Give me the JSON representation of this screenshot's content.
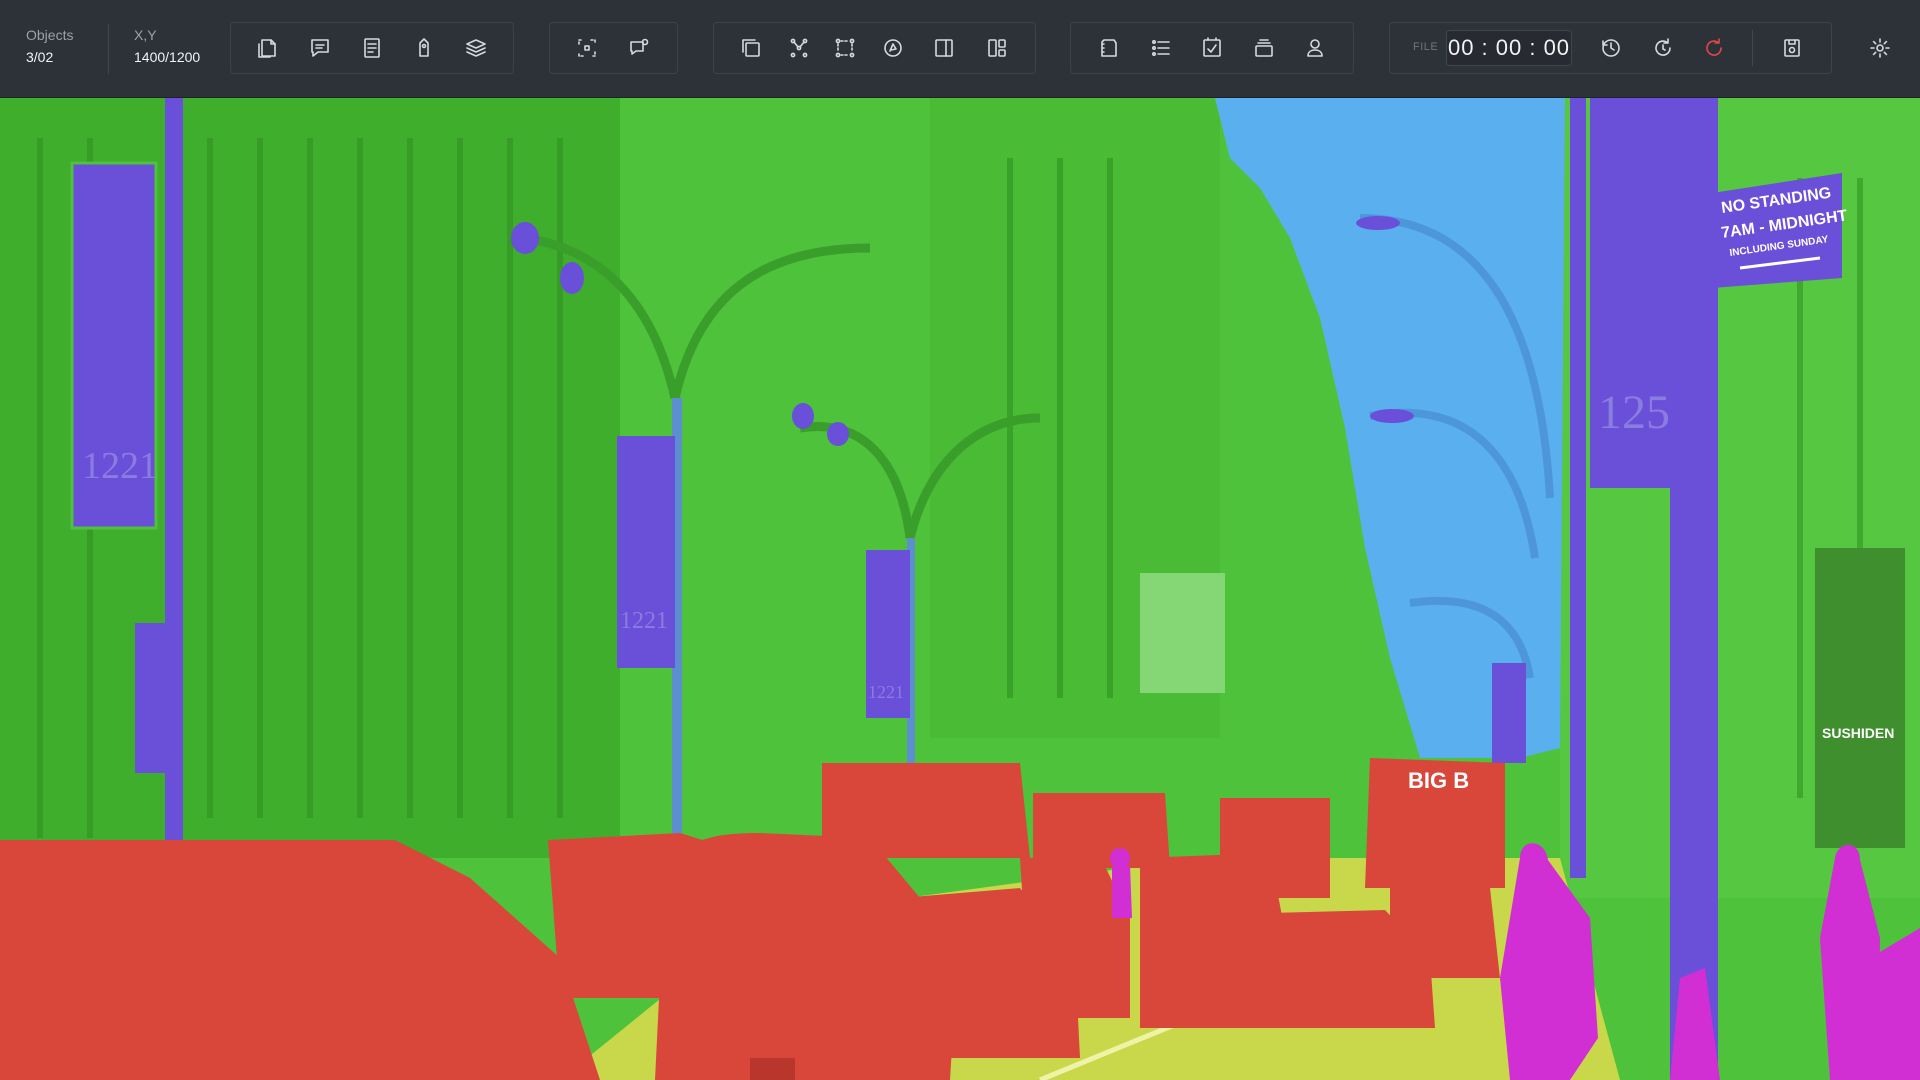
{
  "app": {
    "accent": "#e04848"
  },
  "stats": {
    "objects_label": "Objects",
    "objects_value": "3/02",
    "xy_label": "X,Y",
    "xy_value": "1400/1200"
  },
  "toolbar": {
    "group1": [
      "new-document-icon",
      "comment-icon",
      "list-document-icon",
      "tag-icon",
      "layers-icon"
    ],
    "group2": [
      "select-region-icon",
      "add-comment-icon"
    ],
    "group3": [
      "copy-icon",
      "keypoints-icon",
      "bounding-points-icon",
      "polygon-icon",
      "split-icon",
      "layout-icon"
    ],
    "group4": [
      "clipboard-icon",
      "checklist-icon",
      "checked-document-icon",
      "stack-icon",
      "user-icon"
    ],
    "file_label": "FILE",
    "timer": "00 : 00 : 00",
    "timer_buttons": [
      "history-icon",
      "redo-icon",
      "reset-icon"
    ],
    "save_icon": "save-icon",
    "settings_icon": "gear-icon"
  },
  "scene": {
    "sign_lines": [
      "NO STANDING",
      "7AM - MIDNIGHT",
      "INCLUDING SUNDAY"
    ],
    "banner_texts": [
      "1221",
      "1221",
      "1221",
      "125"
    ],
    "bus_text": "BIG B",
    "storefront": "SUSHIDEN",
    "classes": {
      "building": "#4ec23a",
      "sky": "#5ab0ee",
      "pole": "#6a4fd8",
      "vehicle": "#d9473b",
      "road": "#c9d84a",
      "person": "#d12ed4"
    }
  }
}
